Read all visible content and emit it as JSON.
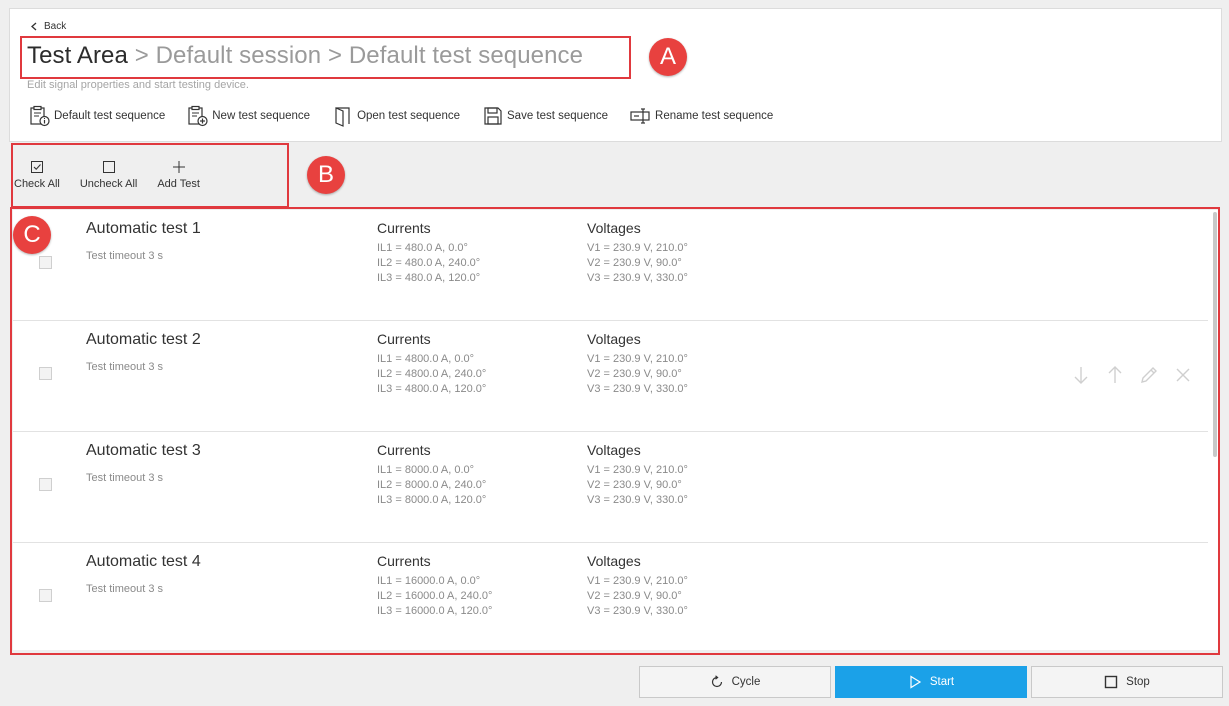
{
  "header": {
    "back_label": "Back",
    "breadcrumb": {
      "current": "Test Area",
      "rest": " > Default session > Default test sequence"
    },
    "subtitle": "Edit signal properties and start testing device."
  },
  "toolbar": {
    "default_label": "Default test sequence",
    "new_label": "New test sequence",
    "open_label": "Open test sequence",
    "save_label": "Save test sequence",
    "rename_label": "Rename test sequence"
  },
  "actions": {
    "check_all": "Check All",
    "uncheck_all": "Uncheck All",
    "add_test": "Add Test"
  },
  "tests": [
    {
      "name": "Automatic test 1",
      "timeout": "Test timeout 3 s",
      "currents_label": "Currents",
      "voltages_label": "Voltages",
      "currents": [
        "IL1 = 480.0 A, 0.0°",
        "IL2 = 480.0 A, 240.0°",
        "IL3 = 480.0 A, 120.0°"
      ],
      "voltages": [
        "V1 = 230.9 V, 210.0°",
        "V2 = 230.9 V, 90.0°",
        "V3 = 230.9 V, 330.0°"
      ]
    },
    {
      "name": "Automatic test 2",
      "timeout": "Test timeout 3 s",
      "currents_label": "Currents",
      "voltages_label": "Voltages",
      "currents": [
        "IL1 = 4800.0 A, 0.0°",
        "IL2 = 4800.0 A, 240.0°",
        "IL3 = 4800.0 A, 120.0°"
      ],
      "voltages": [
        "V1 = 230.9 V, 210.0°",
        "V2 = 230.9 V, 90.0°",
        "V3 = 230.9 V, 330.0°"
      ]
    },
    {
      "name": "Automatic test 3",
      "timeout": "Test timeout 3 s",
      "currents_label": "Currents",
      "voltages_label": "Voltages",
      "currents": [
        "IL1 = 8000.0 A, 0.0°",
        "IL2 = 8000.0 A, 240.0°",
        "IL3 = 8000.0 A, 120.0°"
      ],
      "voltages": [
        "V1 = 230.9 V, 210.0°",
        "V2 = 230.9 V, 90.0°",
        "V3 = 230.9 V, 330.0°"
      ]
    },
    {
      "name": "Automatic test 4",
      "timeout": "Test timeout 3 s",
      "currents_label": "Currents",
      "voltages_label": "Voltages",
      "currents": [
        "IL1 = 16000.0 A, 0.0°",
        "IL2 = 16000.0 A, 240.0°",
        "IL3 = 16000.0 A, 120.0°"
      ],
      "voltages": [
        "V1 = 230.9 V, 210.0°",
        "V2 = 230.9 V, 90.0°",
        "V3 = 230.9 V, 330.0°"
      ]
    }
  ],
  "annotations": {
    "a": "A",
    "b": "B",
    "c": "C"
  },
  "footer": {
    "cycle_label": "Cycle",
    "start_label": "Start",
    "stop_label": "Stop"
  },
  "colors": {
    "accent": "#1ba1e8",
    "annotation": "#e0393e"
  }
}
